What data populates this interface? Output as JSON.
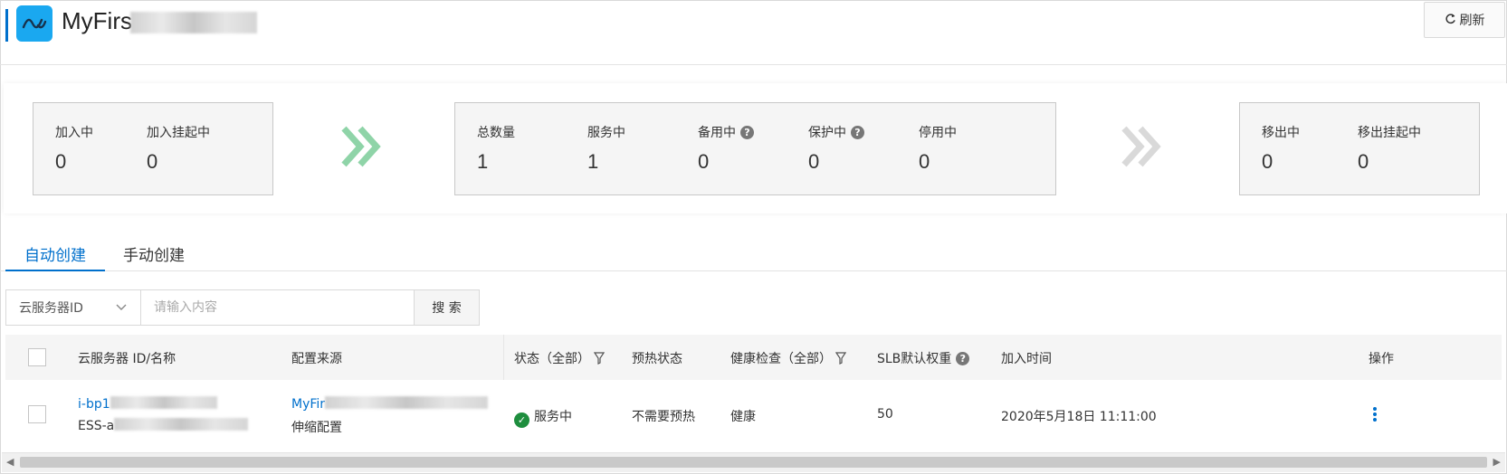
{
  "app": {
    "title": "MyFirs"
  },
  "toolbar": {
    "refresh_label": "刷新"
  },
  "summary": {
    "joining": [
      {
        "label": "加入中",
        "value": "0"
      },
      {
        "label": "加入挂起中",
        "value": "0"
      }
    ],
    "inservice": [
      {
        "label": "总数量",
        "value": "1",
        "help": false
      },
      {
        "label": "服务中",
        "value": "1",
        "help": false
      },
      {
        "label": "备用中",
        "value": "0",
        "help": true
      },
      {
        "label": "保护中",
        "value": "0",
        "help": true
      },
      {
        "label": "停用中",
        "value": "0",
        "help": false
      }
    ],
    "removing": [
      {
        "label": "移出中",
        "value": "0"
      },
      {
        "label": "移出挂起中",
        "value": "0"
      }
    ],
    "colors": {
      "arrow_active": "#8fd4a8",
      "arrow_inactive": "#d9d9d9",
      "accent": "#0070cc"
    }
  },
  "tabs": [
    {
      "label": "自动创建",
      "active": true
    },
    {
      "label": "手动创建",
      "active": false
    }
  ],
  "search": {
    "field_selected": "云服务器ID",
    "placeholder": "请输入内容",
    "button_label": "搜 索"
  },
  "table": {
    "headers": {
      "instance": "云服务器 ID/名称",
      "source": "配置来源",
      "status": "状态（全部）",
      "warmup": "预热状态",
      "health": "健康检查（全部）",
      "slb_weight": "SLB默认权重",
      "join_time": "加入时间",
      "actions": "操作"
    },
    "rows": [
      {
        "instance_id": "i-bp1",
        "instance_name": "ESS-a",
        "source_name": "MyFir",
        "source_type": "伸缩配置",
        "status": "服务中",
        "warmup": "不需要预热",
        "health": "健康",
        "slb_weight": "50",
        "join_time": "2020年5月18日 11:11:00"
      }
    ]
  }
}
